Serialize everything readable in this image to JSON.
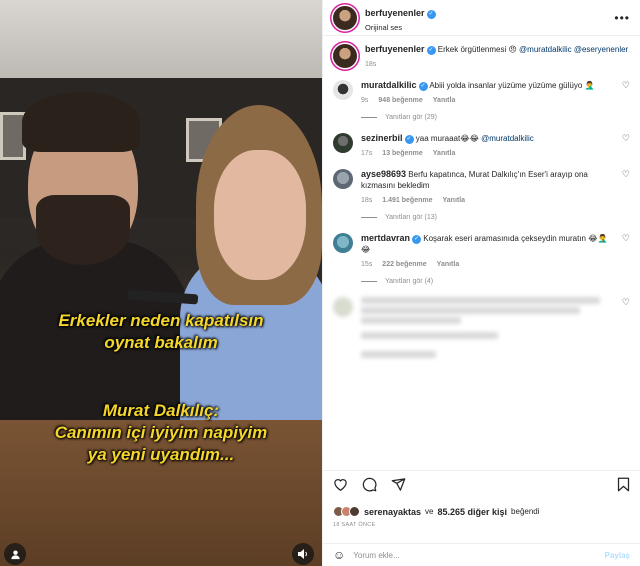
{
  "header": {
    "username": "berfuyenenler",
    "verified_icon": "verified-badge-icon",
    "subtitle": "Orijinal ses",
    "more_icon": "more-horizontal-icon",
    "more_glyph": "•••"
  },
  "video": {
    "caption_lines_1": [
      "Erkekler neden kapatılsın",
      "oynat bakalım"
    ],
    "caption_lines_2": [
      "Murat Dalkılıç:",
      "Canımın içi iyiyim napiyim",
      "ya yeni uyandım..."
    ],
    "user_icon": "user-tag-icon",
    "mute_icon": "volume-icon"
  },
  "post": {
    "username": "berfuyenenler",
    "text": "Erkek örgütlenmesi 😠",
    "mentions": "@muratdalkilic @eseryenenler",
    "time": "18s"
  },
  "comments": [
    {
      "username": "muratdalkilic",
      "verified": true,
      "text": "Abiii yolda insanlar yüzüme yüzüme gülüyo 🤦‍♂️",
      "time": "9s",
      "likes": "948 beğenme",
      "reply": "Yanıtla",
      "view_replies": "Yanıtları gör (29)"
    },
    {
      "username": "sezinerbil",
      "verified": true,
      "text": "yaa muraaat😂😂 ",
      "mention": "@muratdalkilic",
      "time": "17s",
      "likes": "13 beğenme",
      "reply": "Yanıtla"
    },
    {
      "username": "ayse98693",
      "verified": false,
      "text": "Berfu kapatınca, Murat Dalkılıç'ın Eser'i arayıp ona kızmasını bekledim",
      "time": "18s",
      "likes": "1.491 beğenme",
      "reply": "Yanıtla",
      "view_replies": "Yanıtları gör (13)"
    },
    {
      "username": "mertdavran",
      "verified": true,
      "text": "Koşarak eseri aramasınıda çekseydin muratın 😂🤦‍♂️😂",
      "time": "15s",
      "likes": "222 beğenme",
      "reply": "Yanıtla",
      "view_replies": "Yanıtları gör (4)"
    }
  ],
  "likes": {
    "liked_by_user": "serenayaktas",
    "connector": "ve",
    "others": "85.265 diğer kişi",
    "suffix": "beğendi"
  },
  "date": "18 SAAT ÖNCE",
  "add_comment": {
    "placeholder": "Yorum ekle...",
    "post_label": "Paylaş"
  },
  "icons": {
    "heart_small": "♡",
    "like": "♡",
    "comment": "◯",
    "share": "➤",
    "save": "⌑",
    "emoji": "☺"
  },
  "colors": {
    "accent": "#3897f0",
    "caption": "#f5d62a",
    "mention": "#00376b"
  }
}
